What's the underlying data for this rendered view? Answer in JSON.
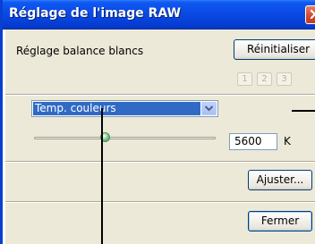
{
  "window": {
    "title": "Réglage de l'image RAW",
    "close_icon": "close-icon"
  },
  "white_balance": {
    "label": "Réglage balance blancs",
    "reset_label": "Réinitialiser",
    "pages": [
      "1",
      "2",
      "3"
    ]
  },
  "mode_select": {
    "selected": "Temp. couleurs",
    "arrow_icon": "chevron-down-icon"
  },
  "temperature": {
    "slider_fraction": 0.37,
    "value": "5600",
    "unit": "K"
  },
  "footer": {
    "adjust_label": "Ajuster...",
    "close_label": "Fermer"
  },
  "colors": {
    "titlebar": "#0a4ae4",
    "dialog_bg": "#ece9d8",
    "selection": "#316ac5"
  }
}
